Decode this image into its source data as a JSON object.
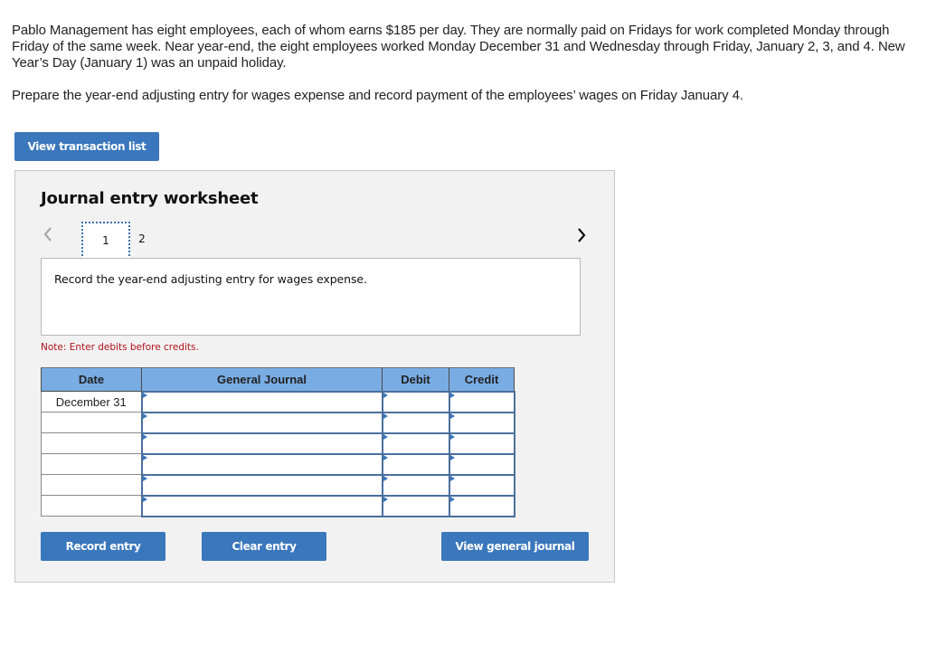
{
  "problem": {
    "paragraph": "Pablo Management has eight employees, each of whom earns $185 per day. They are normally paid on Fridays for work completed Monday through Friday of the same week. Near year-end, the eight employees worked Monday December 31 and Wednesday through Friday, January 2, 3, and 4. New Year’s Day (January 1) was an unpaid holiday.",
    "instruction": "Prepare the year-end adjusting entry for wages expense and record payment of the employees’ wages on Friday January 4."
  },
  "buttons": {
    "view_transaction_list": "View transaction list",
    "record_entry": "Record entry",
    "clear_entry": "Clear entry",
    "view_general_journal": "View general journal"
  },
  "worksheet": {
    "title": "Journal entry worksheet",
    "tabs": [
      {
        "label": "1",
        "active": true
      },
      {
        "label": "2",
        "active": false
      }
    ],
    "nav_prev_icon": "chevron-left-icon",
    "nav_next_icon": "chevron-right-icon",
    "description": "Record the year-end adjusting entry for wages expense.",
    "note": "Note: Enter debits before credits."
  },
  "journal": {
    "columns": [
      "Date",
      "General Journal",
      "Debit",
      "Credit"
    ],
    "rows": [
      {
        "date": "December 31",
        "account": "",
        "debit": "",
        "credit": ""
      },
      {
        "date": "",
        "account": "",
        "debit": "",
        "credit": ""
      },
      {
        "date": "",
        "account": "",
        "debit": "",
        "credit": ""
      },
      {
        "date": "",
        "account": "",
        "debit": "",
        "credit": ""
      },
      {
        "date": "",
        "account": "",
        "debit": "",
        "credit": ""
      },
      {
        "date": "",
        "account": "",
        "debit": "",
        "credit": ""
      }
    ]
  },
  "colors": {
    "button_blue": "#3a77bc",
    "header_blue": "#79ace3",
    "note_red": "#b0121b",
    "panel_bg": "#f2f2f2"
  }
}
